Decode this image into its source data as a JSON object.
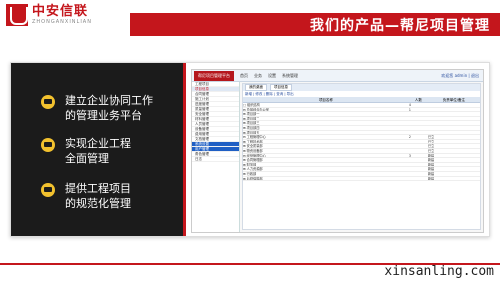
{
  "brand": {
    "cn": "中安信联",
    "en": "ZHONGANXINLIAN"
  },
  "banner": {
    "title": "我们的产品—帮尼项目管理"
  },
  "features": [
    {
      "text": "建立企业协同工作\n的管理业务平台"
    },
    {
      "text": "实现企业工程\n全面管理"
    },
    {
      "text": "提供工程项目\n的规范化管理"
    }
  ],
  "screenshot": {
    "brand": "帮尼项目管理平台",
    "nav": [
      "首页",
      "业务",
      "设置",
      "系统管理"
    ],
    "user": "欢迎您 admin | 退出",
    "tabs": [
      "我的桌面",
      "项目信息"
    ],
    "toolbar": "新增 | 修改 | 删除 | 查询 | 导出",
    "columns": [
      "项目名称",
      "人数",
      "负责单位/备注"
    ],
    "sidebar": [
      "工程项目",
      "项目信息",
      "合同管理",
      "施工计划",
      "进度管理",
      "质量管理",
      "安全管理",
      "材料管理",
      "人员管理",
      "设备管理",
      "费用管理",
      "文档管理",
      "系统设置",
      "用户管理",
      "角色管理",
      "日志"
    ],
    "rows": [
      [
        "□ 组织结构",
        "4",
        ""
      ],
      [
        "  ⊟ 总部综合办公室",
        "1",
        ""
      ],
      [
        "    ⊞ 项目部一",
        "",
        ""
      ],
      [
        "    ⊞ 项目部二",
        "",
        ""
      ],
      [
        "    ⊞ 项目部三",
        "",
        ""
      ],
      [
        "    ⊞ 项目部四",
        "",
        ""
      ],
      [
        "    ⊞ 项目部五",
        "",
        ""
      ],
      [
        "  ⊟ 工程管理中心",
        "2",
        "已立"
      ],
      [
        "    ⊞ 工程技术部",
        "",
        "已立"
      ],
      [
        "    ⊞ 安全质量部",
        "",
        "已立"
      ],
      [
        "    ⊞ 物资设备部",
        "",
        "已立"
      ],
      [
        "  ⊟ 经营管理中心",
        "3",
        "新建"
      ],
      [
        "    ⊞ 合同管理部",
        "",
        "新建"
      ],
      [
        "    ⊞ 财务部",
        "",
        "新建"
      ],
      [
        "    ⊞ 人力资源部",
        "",
        "新建"
      ],
      [
        "    ⊞ 行政部",
        "",
        "新建"
      ],
      [
        "  ⊞ 后勤保障部",
        "",
        "新建"
      ]
    ]
  },
  "footer": {
    "url": "xinsanling.com"
  }
}
